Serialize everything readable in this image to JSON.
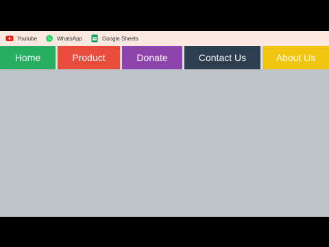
{
  "bookmarks": [
    {
      "label": "Youtube",
      "icon": "youtube-icon",
      "color": "#e62117"
    },
    {
      "label": "WhatsApp",
      "icon": "whatsapp-icon",
      "color": "#25d366"
    },
    {
      "label": "Google Sheets",
      "icon": "google-sheets-icon",
      "color": "#0f9d58"
    }
  ],
  "nav": {
    "items": [
      {
        "label": "Home",
        "color": "#27ae60"
      },
      {
        "label": "Product",
        "color": "#e74c3c"
      },
      {
        "label": "Donate",
        "color": "#8e44ad"
      },
      {
        "label": "Contact Us",
        "color": "#2c3e50"
      },
      {
        "label": "About Us",
        "color": "#f1c40f"
      }
    ]
  },
  "colors": {
    "page_background": "#bec3c7",
    "bookmarks_bar_background": "#fae8e1",
    "nav_separator": "#dfe4e8",
    "letterbox": "#000000"
  }
}
